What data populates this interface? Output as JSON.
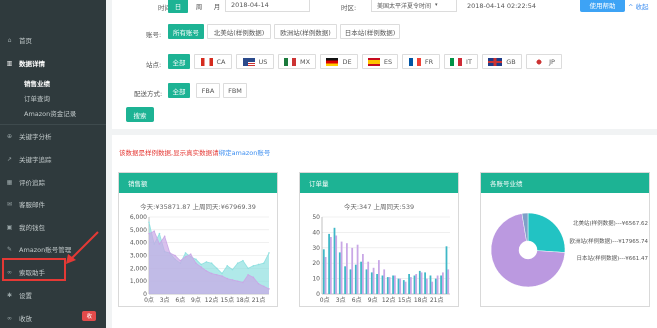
{
  "sidebar": {
    "home": "首页",
    "data_details": "数据详情",
    "sub_sales": "销售业绩",
    "sub_orders": "订单查询",
    "sub_funds": "Amazon资金记录",
    "keyword_analysis": "关键字分析",
    "keyword_tracking": "关键字追踪",
    "review_monitor": "评价追踪",
    "customer_mail": "客服邮件",
    "my_wallet": "我的钱包",
    "amazon_accounts": "Amazon账号管理",
    "lottery_helper": "索取助手",
    "settings": "设置",
    "collapse": "收放",
    "badge": "收"
  },
  "filters": {
    "time_label": "时间:",
    "time_tabs": [
      "日",
      "周",
      "月"
    ],
    "date_value": "2018-04-14",
    "tz_label": "时区:",
    "tz_value": "美国太平洋夏令时间",
    "tz_time": "2018-04-14 02:22:54",
    "help_btn": "使用帮助",
    "collapse_link": "收起",
    "account_label": "账号:",
    "accounts": [
      "所有账号",
      "北美站(样例数据)",
      "欧洲站(样例数据)",
      "日本站(样例数据)"
    ],
    "site_label": "站点:",
    "sites": [
      "全部",
      "CA",
      "US",
      "MX",
      "DE",
      "ES",
      "FR",
      "IT",
      "GB",
      "JP"
    ],
    "ship_label": "配送方式:",
    "ship": [
      "全部",
      "FBA",
      "FBM"
    ],
    "search_btn": "搜索"
  },
  "notice": {
    "text": "该数据是样例数据,显示真实数据请",
    "link": "绑定amazon账号"
  },
  "panels": {
    "sales": {
      "title": "销售额",
      "stat": "今天:¥35871.87  上周同天:¥67969.39"
    },
    "orders": {
      "title": "订单量",
      "stat": "今天:347  上周同天:539"
    },
    "accounts": {
      "title": "各账号业绩",
      "legend": [
        "北美站(样例数据)---¥6567.62",
        "欧洲站(样例数据)---¥17965.74",
        "日本站(样例数据)---¥661.47"
      ]
    }
  },
  "chart_data": [
    {
      "type": "area",
      "x": [
        "0点",
        "3点",
        "6点",
        "9点",
        "12点",
        "15点",
        "18点",
        "21点"
      ],
      "yticks": [
        "6,000",
        "5,000",
        "4,000",
        "3,000",
        "2,000",
        "1,000",
        "0"
      ],
      "ylim": [
        0,
        6000
      ],
      "series": [
        {
          "values": [
            5600,
            3900,
            4700,
            3300,
            3200,
            2700,
            2400,
            3200,
            2900,
            2700,
            2300,
            2500,
            2400,
            2000,
            1600,
            2200,
            1900,
            2400,
            2600,
            2000,
            2200,
            2300,
            2400,
            3200
          ],
          "color": "#8fe0e0"
        },
        {
          "values": [
            4700,
            4900,
            3900,
            4500,
            3200,
            3000,
            2600,
            2900,
            3100,
            2400,
            2100,
            1800,
            1600,
            1500,
            1400,
            1200,
            1100,
            1000,
            900,
            1500,
            1300,
            800,
            600,
            400
          ],
          "color": "#c9a7e6"
        }
      ]
    },
    {
      "type": "bar",
      "categories": [
        "0点",
        "3点",
        "6点",
        "9点",
        "12点",
        "15点",
        "18点",
        "21点"
      ],
      "yticks": [
        "50",
        "40",
        "30",
        "20",
        "10",
        "0"
      ],
      "ylim": [
        0,
        50
      ],
      "series": [
        {
          "values": [
            29,
            39,
            43,
            27,
            18,
            16,
            19,
            21,
            16,
            14,
            13,
            12,
            11,
            12,
            10,
            9,
            13,
            12,
            15,
            14,
            12,
            10,
            12,
            31
          ],
          "color": "#3fb8c7"
        },
        {
          "values": [
            24,
            37,
            38,
            34,
            33,
            30,
            32,
            26,
            21,
            17,
            22,
            16,
            11,
            12,
            10,
            8,
            11,
            13,
            14,
            10,
            8,
            12,
            14,
            16
          ],
          "color": "#c9a7e6"
        }
      ]
    },
    {
      "type": "pie",
      "labels": [
        "北美站(样例数据)",
        "欧洲站(样例数据)",
        "日本站(样例数据)"
      ],
      "values": [
        6567.62,
        17965.74,
        661.47
      ],
      "colors": [
        "#22c3c3",
        "#bb99e0",
        "#7fa0c8"
      ]
    }
  ]
}
